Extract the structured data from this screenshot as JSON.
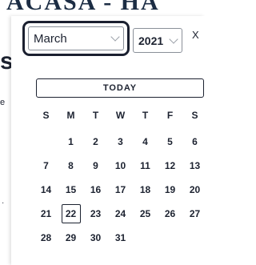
{
  "background": {
    "header_text": "ACASA - HA",
    "left_fragment_top": "s",
    "left_fragment_mid": "e",
    "left_fragment_low": "·"
  },
  "datepicker": {
    "month_value": "March",
    "year_value": "2021",
    "close_label": "X",
    "today_label": "TODAY",
    "selected_day": "22",
    "weekdays": [
      "S",
      "M",
      "T",
      "W",
      "T",
      "F",
      "S"
    ],
    "days": [
      [
        "",
        "1",
        "2",
        "3",
        "4",
        "5",
        "6"
      ],
      [
        "7",
        "8",
        "9",
        "10",
        "11",
        "12",
        "13"
      ],
      [
        "14",
        "15",
        "16",
        "17",
        "18",
        "19",
        "20"
      ],
      [
        "21",
        "22",
        "23",
        "24",
        "25",
        "26",
        "27"
      ],
      [
        "28",
        "29",
        "30",
        "31",
        "",
        "",
        ""
      ]
    ]
  },
  "colors": {
    "text": "#1c2230",
    "focus_border": "#1b2030",
    "field_border": "#8a9099"
  }
}
